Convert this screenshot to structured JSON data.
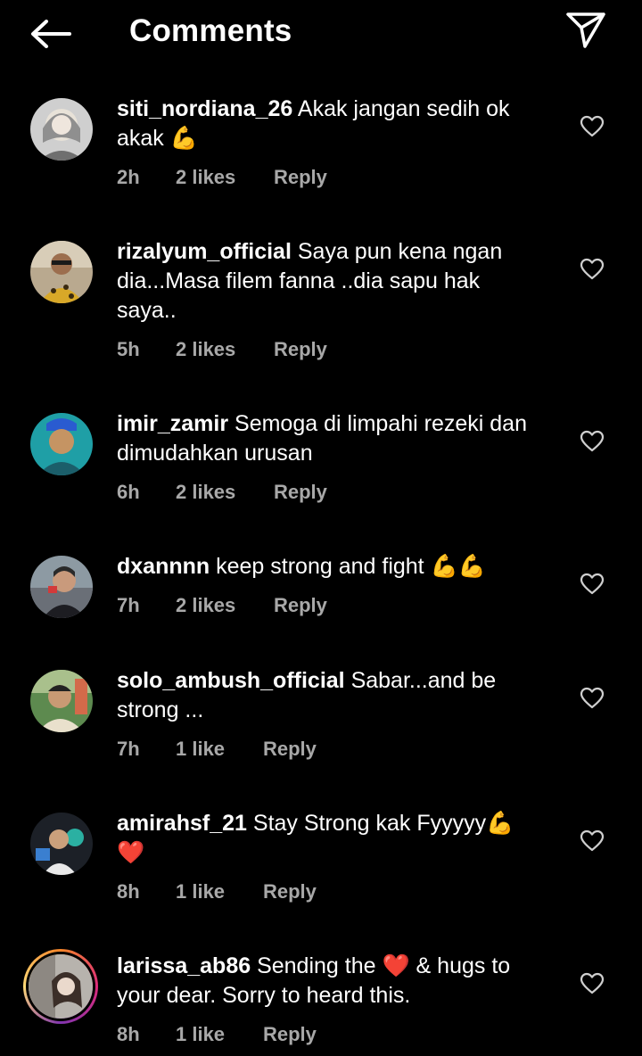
{
  "header": {
    "title": "Comments",
    "back_icon": "arrow-left-icon",
    "send_icon": "paper-plane-icon"
  },
  "comments": [
    {
      "username": "siti_nordiana_26",
      "text": "Akak jangan sedih ok akak 💪",
      "time": "2h",
      "likes": "2 likes",
      "reply": "Reply"
    },
    {
      "username": "rizalyum_official",
      "text": "Saya pun kena ngan dia...Masa filem fanna ..dia sapu hak saya..",
      "time": "5h",
      "likes": "2 likes",
      "reply": "Reply"
    },
    {
      "username": "imir_zamir",
      "text": "Semoga di limpahi rezeki dan dimudahkan urusan",
      "time": "6h",
      "likes": "2 likes",
      "reply": "Reply"
    },
    {
      "username": "dxannnn",
      "text": "keep strong and fight 💪💪",
      "time": "7h",
      "likes": "2 likes",
      "reply": "Reply"
    },
    {
      "username": "solo_ambush_official",
      "text": "Sabar...and be strong ...",
      "time": "7h",
      "likes": "1 like",
      "reply": "Reply"
    },
    {
      "username": "amirahsf_21",
      "text": "Stay Strong kak Fyyyyy💪 ❤️",
      "time": "8h",
      "likes": "1 like",
      "reply": "Reply"
    },
    {
      "username": "larissa_ab86",
      "text": "Sending the ❤️ & hugs to your dear. Sorry to heard this.",
      "time": "8h",
      "likes": "1 like",
      "reply": "Reply"
    }
  ],
  "colors": {
    "background": "#000000",
    "text": "#ffffff",
    "meta": "#a8a8a8"
  }
}
